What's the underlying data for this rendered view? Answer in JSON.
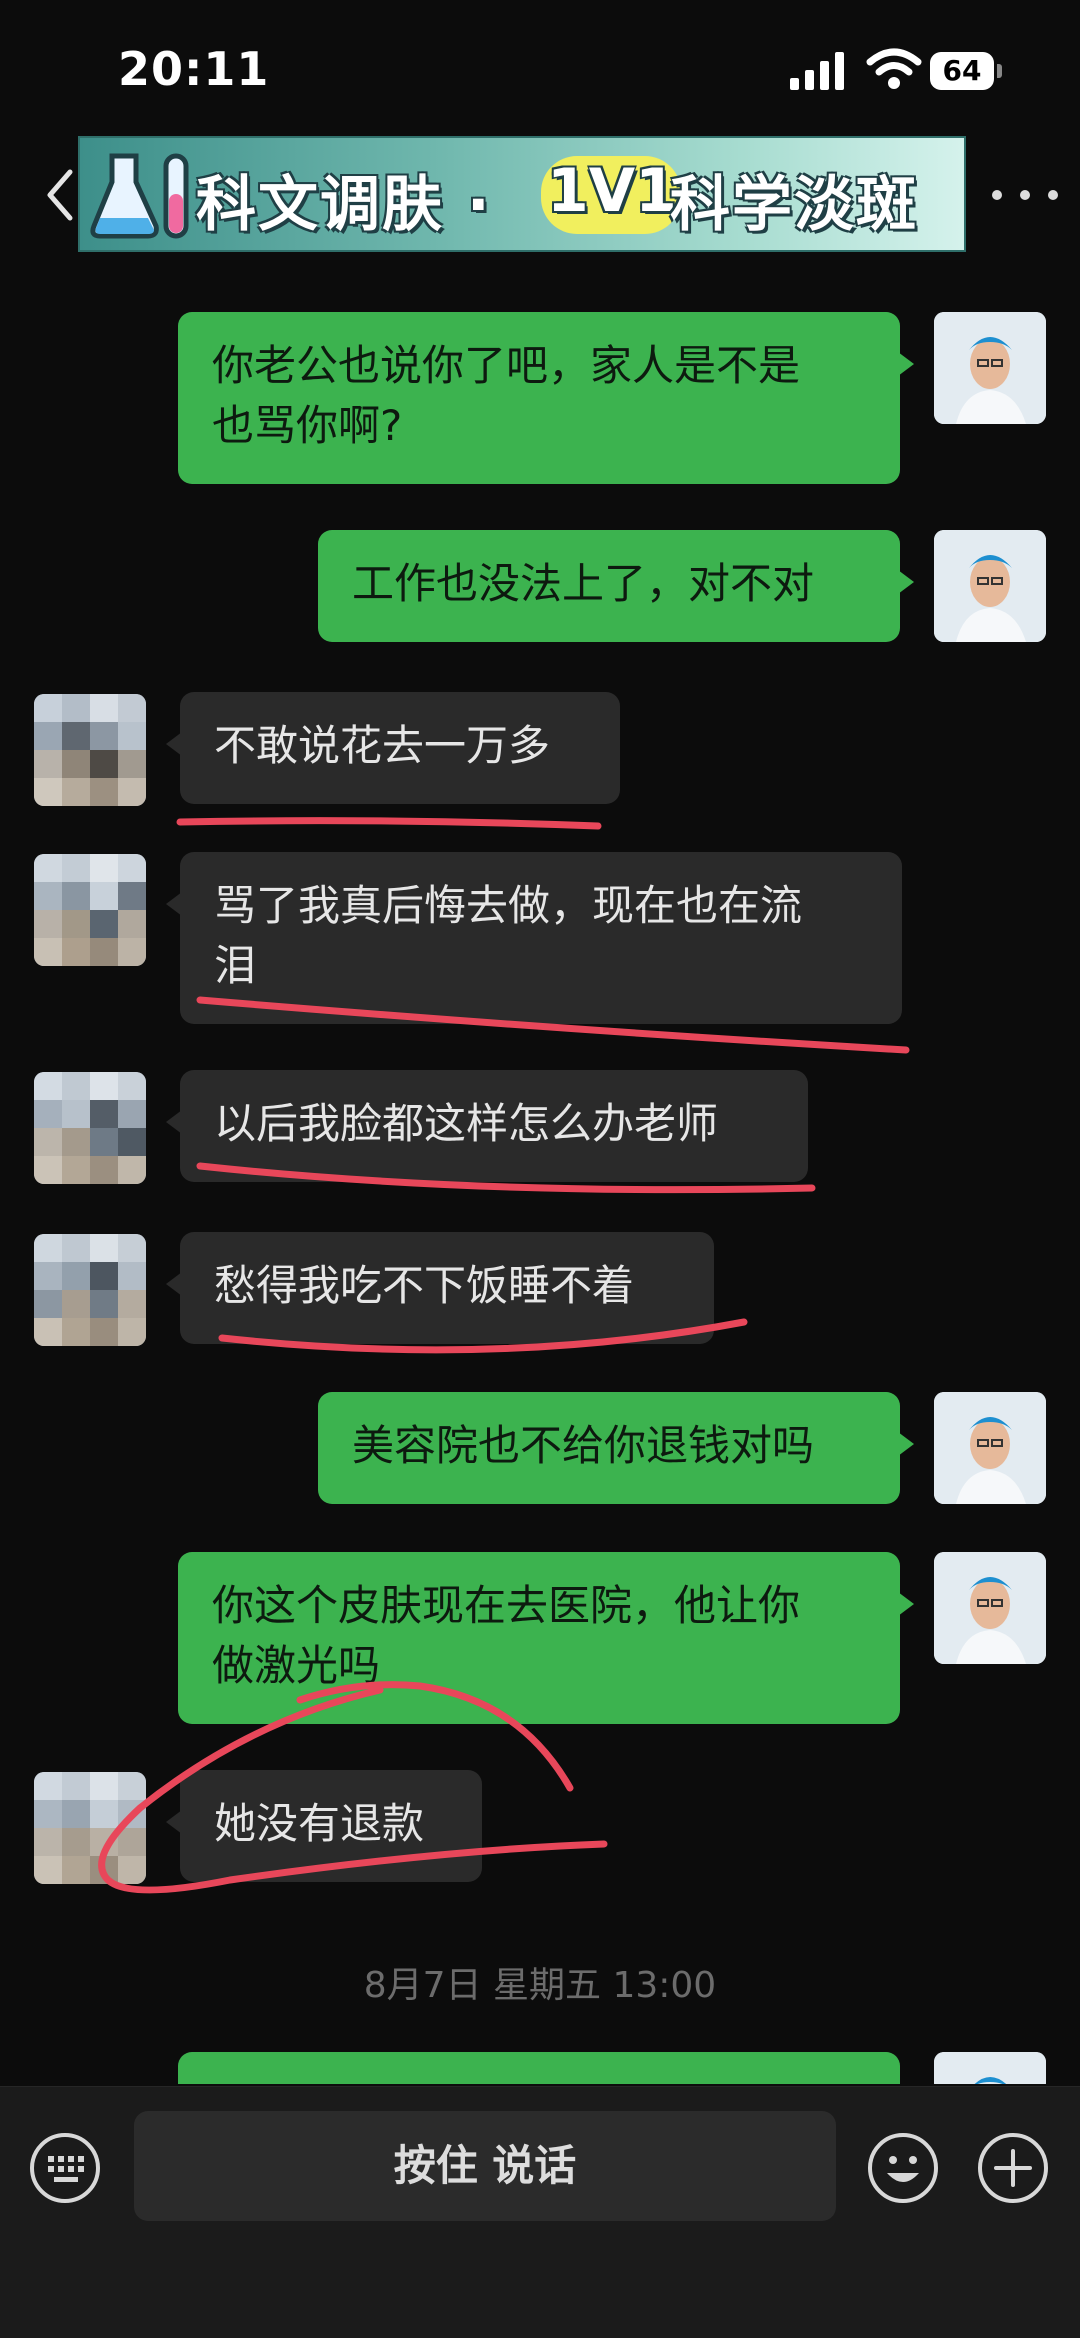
{
  "status_bar": {
    "time": "20:11",
    "battery": "64"
  },
  "header": {
    "banner_title": "科文调肤 ·",
    "banner_badge": "1V1",
    "banner_subtitle": "科学淡斑",
    "accent_color": "#3cb34f"
  },
  "messages": [
    {
      "side": "out",
      "lines": [
        "你老公也说你了吧，家人是不是",
        "也骂你啊?"
      ]
    },
    {
      "side": "out",
      "lines": [
        "工作也没法上了，对不对"
      ]
    },
    {
      "side": "in",
      "lines": [
        "不敢说花去一万多"
      ]
    },
    {
      "side": "in",
      "lines": [
        "骂了我真后悔去做，现在也在流",
        "泪"
      ]
    },
    {
      "side": "in",
      "lines": [
        "以后我脸都这样怎么办老师"
      ]
    },
    {
      "side": "in",
      "lines": [
        "愁得我吃不下饭睡不着"
      ]
    },
    {
      "side": "out",
      "lines": [
        "美容院也不给你退钱对吗"
      ]
    },
    {
      "side": "out",
      "lines": [
        "你这个皮肤现在去医院，他让你",
        "做激光吗"
      ]
    },
    {
      "side": "in",
      "lines": [
        "她没有退款"
      ]
    }
  ],
  "timestamp": "8月7日 星期五 13:00",
  "input_bar": {
    "voice_label": "按住 说话"
  },
  "icons": [
    "back-arrow-icon",
    "flask-icon",
    "more-icon",
    "keyboard-icon",
    "emoji-icon",
    "plus-icon"
  ]
}
